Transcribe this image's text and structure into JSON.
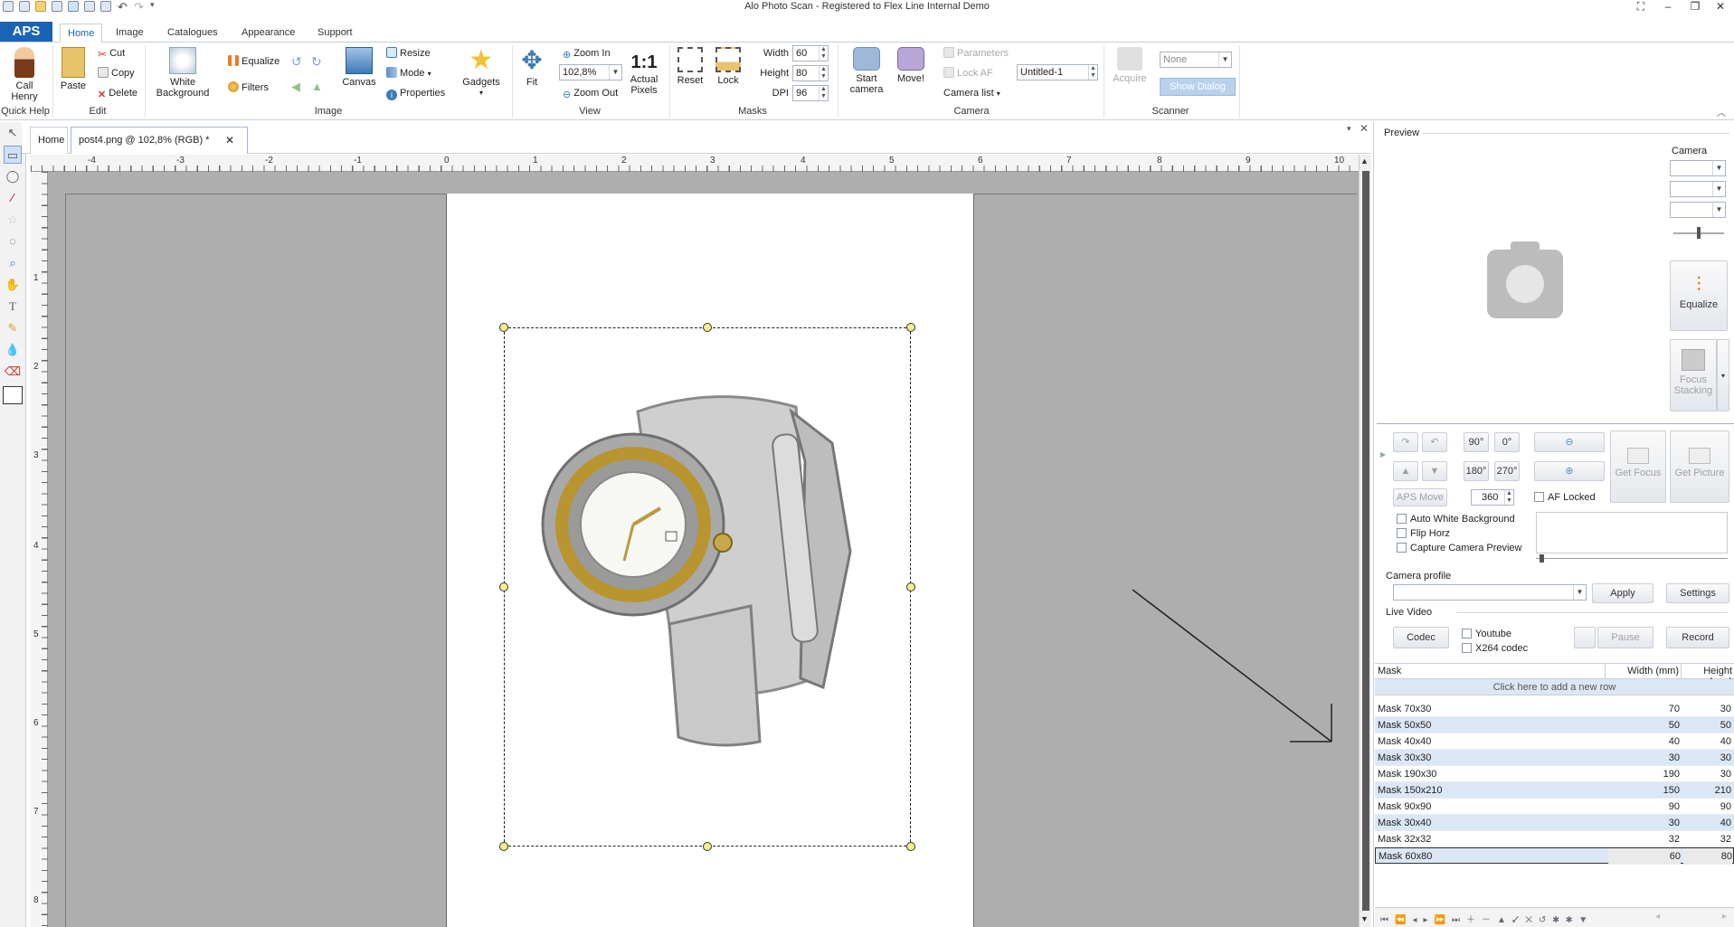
{
  "window": {
    "title": "Alo Photo Scan - Registered to Flex Line Internal Demo"
  },
  "ribbon_tabs": [
    {
      "label": "Home",
      "active": true
    },
    {
      "label": "Image"
    },
    {
      "label": "Catalogues"
    },
    {
      "label": "Appearance"
    },
    {
      "label": "Support"
    }
  ],
  "app_button": "APS",
  "groups": {
    "quickhelp": {
      "label": "Quick Help",
      "call_henry": "Call\nHenry"
    },
    "edit": {
      "label": "Edit",
      "paste": "Paste",
      "cut": "Cut",
      "copy": "Copy",
      "delete": "Delete"
    },
    "image": {
      "label": "Image",
      "white_bg": "White\nBackground",
      "equalize": "Equalize",
      "filters": "Filters",
      "canvas": "Canvas",
      "resize": "Resize",
      "mode": "Mode",
      "properties": "Properties",
      "gadgets": "Gadgets"
    },
    "view": {
      "label": "View",
      "fit": "Fit",
      "zoom_in": "Zoom In",
      "zoom_out": "Zoom Out",
      "zoom_value": "102,8%",
      "actual_pixels": "Actual\nPixels",
      "one_to_one": "1:1"
    },
    "masks": {
      "label": "Masks",
      "width_label": "Width",
      "width_value": "60",
      "height_label": "Height",
      "height_value": "80",
      "dpi_label": "DPI",
      "dpi_value": "96",
      "reset": "Reset",
      "lock": "Lock"
    },
    "camera": {
      "label": "Camera",
      "start_camera": "Start\ncamera",
      "move": "Move!",
      "parameters": "Parameters",
      "lock_af": "Lock AF",
      "camera_list": "Camera list",
      "profile_value": "Untitled-1"
    },
    "scanner": {
      "label": "Scanner",
      "acquire": "Acquire",
      "device_value": "None",
      "show_dialog": "Show Dialog"
    }
  },
  "document_tabs": [
    {
      "label": "Home"
    },
    {
      "label": "post4.png @ 102,8% (RGB) *",
      "active": true
    }
  ],
  "ruler": {
    "top_ticks": [
      "-4",
      "-3",
      "-2",
      "-1",
      "0",
      "1",
      "2",
      "3",
      "4",
      "5",
      "6",
      "7",
      "8",
      "9",
      "10"
    ],
    "left_ticks": [
      "1",
      "2",
      "3",
      "4",
      "5",
      "6",
      "7",
      "8"
    ]
  },
  "preview_panel": {
    "title": "Preview",
    "camera_label": "Camera",
    "equalize": "Equalize",
    "focus_stacking": "Focus\nStacking",
    "rot_90": "90°",
    "rot_0": "0°",
    "rot_180": "180°",
    "rot_270": "270°",
    "get_focus": "Get Focus",
    "get_picture": "Get Picture",
    "aps_move": "APS Move",
    "move_value": "360",
    "af_locked": "AF Locked",
    "auto_white_bg": "Auto White Background",
    "flip_horz": "Flip Horz",
    "capture_preview": "Capture Camera Preview",
    "camera_profile_label": "Camera profile",
    "apply": "Apply",
    "settings": "Settings",
    "live_video_label": "Live Video",
    "codec": "Codec",
    "youtube": "Youtube",
    "x264": "X264 codec",
    "pause": "Pause",
    "record": "Record"
  },
  "mask_table": {
    "headers": [
      "Mask",
      "Width (mm)",
      "Height (mm)"
    ],
    "add_row": "Click here to add a new row",
    "rows": [
      {
        "name": "Mask 70x30",
        "w": "70",
        "h": "30"
      },
      {
        "name": "Mask 50x50",
        "w": "50",
        "h": "50"
      },
      {
        "name": "Mask 40x40",
        "w": "40",
        "h": "40"
      },
      {
        "name": "Mask 30x30",
        "w": "30",
        "h": "30"
      },
      {
        "name": "Mask 190x30",
        "w": "190",
        "h": "30"
      },
      {
        "name": "Mask 150x210",
        "w": "150",
        "h": "210"
      },
      {
        "name": "Mask 90x90",
        "w": "90",
        "h": "90"
      },
      {
        "name": "Mask 30x40",
        "w": "30",
        "h": "40"
      },
      {
        "name": "Mask 32x32",
        "w": "32",
        "h": "32"
      },
      {
        "name": "Mask 60x80",
        "w": "60",
        "h": "80"
      }
    ]
  },
  "colors": {
    "accent": "#1b63b4",
    "canvas_bg": "#aeaeae",
    "row_alt": "#dce7f6"
  }
}
